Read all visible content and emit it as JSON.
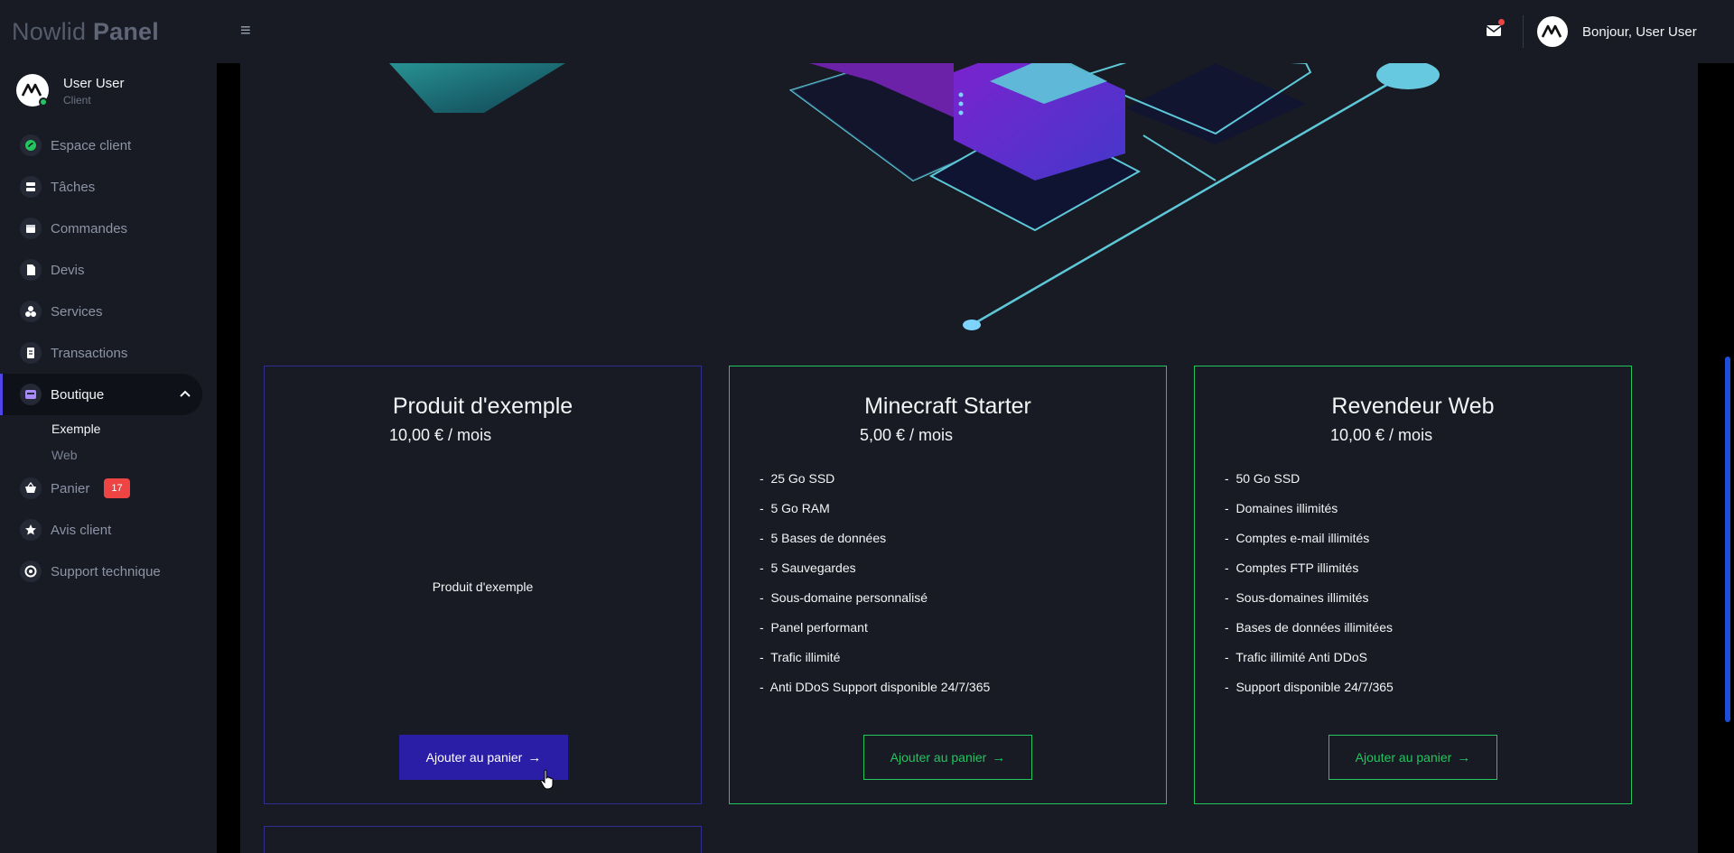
{
  "brand": {
    "light": "Nowlid",
    "bold": "Panel"
  },
  "topbar": {
    "greeting": "Bonjour, User User",
    "mail_icon": "mail-icon",
    "has_notification": true
  },
  "user": {
    "name": "User User",
    "role": "Client"
  },
  "nav": {
    "items": [
      {
        "label": "Espace client",
        "icon": "dashboard-icon"
      },
      {
        "label": "Tâches",
        "icon": "tasks-icon"
      },
      {
        "label": "Commandes",
        "icon": "orders-icon"
      },
      {
        "label": "Devis",
        "icon": "quote-icon"
      },
      {
        "label": "Services",
        "icon": "services-icon"
      },
      {
        "label": "Transactions",
        "icon": "receipt-icon"
      },
      {
        "label": "Boutique",
        "icon": "shop-icon"
      },
      {
        "label": "Panier",
        "icon": "basket-icon"
      },
      {
        "label": "Avis client",
        "icon": "star-icon"
      },
      {
        "label": "Support technique",
        "icon": "support-icon"
      }
    ],
    "boutique_sub": [
      {
        "label": "Exemple"
      },
      {
        "label": "Web"
      }
    ],
    "cart_count": "17"
  },
  "products": [
    {
      "title": "Produit d'exemple",
      "price": "10,00 € / mois",
      "description": "Produit d'exemple",
      "features": [],
      "button": "Ajouter au panier"
    },
    {
      "title": "Minecraft Starter",
      "price": "5,00 € / mois",
      "description": "",
      "features": [
        "25 Go SSD",
        "5 Go RAM",
        "5 Bases de données",
        "5 Sauvegardes",
        "Sous-domaine personnalisé",
        "Panel performant",
        "Trafic illimité",
        "Anti DDoS Support disponible 24/7/365"
      ],
      "button": "Ajouter au panier"
    },
    {
      "title": "Revendeur Web",
      "price": "10,00 € / mois",
      "description": "",
      "features": [
        "50 Go SSD",
        "Domaines illimités",
        "Comptes e-mail illimités",
        "Comptes FTP illimités",
        "Sous-domaines illimités",
        "Bases de données illimitées",
        "Trafic illimité Anti DDoS",
        "Support disponible 24/7/365"
      ],
      "button": "Ajouter au panier"
    }
  ],
  "colors": {
    "accent": "#2b1ea6",
    "success": "#22c55e",
    "danger": "#ef4444",
    "bg": "#181b24"
  }
}
